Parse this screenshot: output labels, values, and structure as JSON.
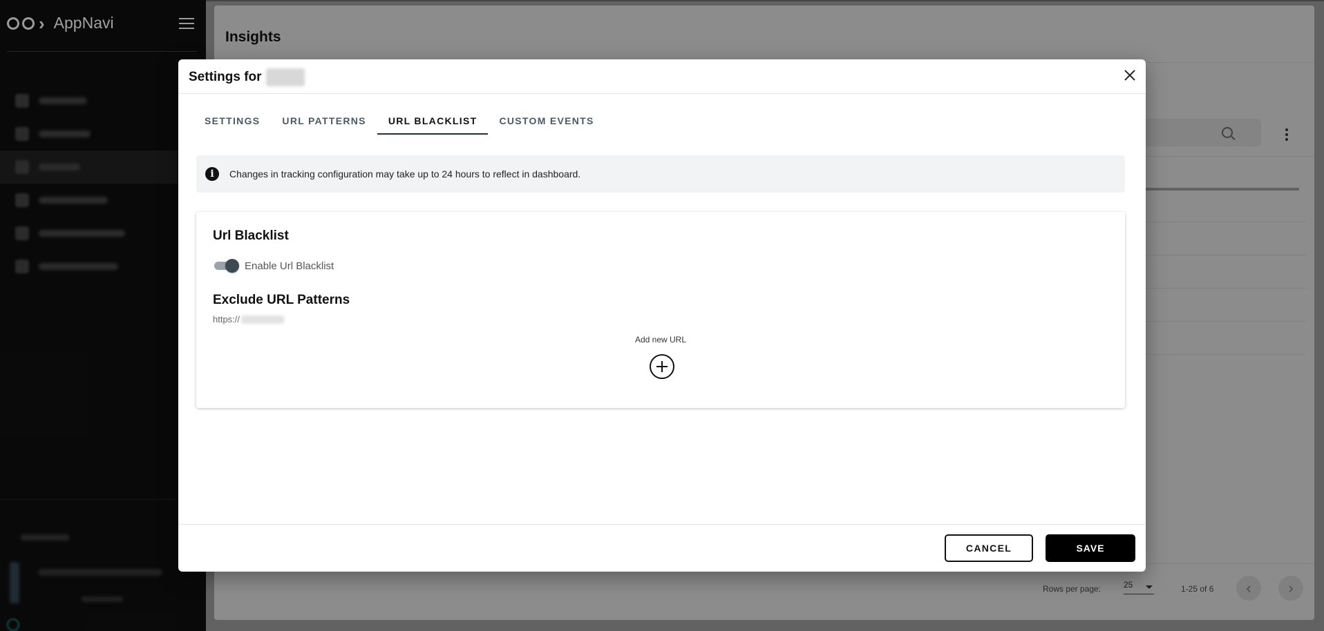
{
  "app": {
    "name": "AppNavi"
  },
  "sidebar": {
    "items": [
      {
        "icon": "dashboard-icon",
        "label": ""
      },
      {
        "icon": "discovery-icon",
        "label": ""
      },
      {
        "icon": "insights-icon",
        "label": ""
      },
      {
        "icon": "media-library-icon",
        "label": ""
      },
      {
        "icon": "target-audience-icon",
        "label": ""
      },
      {
        "icon": "message-board-icon",
        "label": ""
      }
    ],
    "active_index": 2
  },
  "page": {
    "title": "Insights",
    "pagination": {
      "rows_label": "Rows per page:",
      "rows_value": "25",
      "range": "1-25 of 6"
    }
  },
  "modal": {
    "title": "Settings for",
    "tabs": [
      {
        "label": "Settings"
      },
      {
        "label": "URL Patterns"
      },
      {
        "label": "URL Blacklist"
      },
      {
        "label": "Custom Events"
      }
    ],
    "active_tab": 2,
    "info_text": "Changes in tracking configuration may take up to 24 hours to reflect in dashboard.",
    "card": {
      "title": "Url Blacklist",
      "toggle_label": "Enable Url Blacklist",
      "toggle_on": true,
      "section_title": "Exclude URL Patterns",
      "url_prefix": "https://",
      "add_label": "Add new URL"
    },
    "buttons": {
      "cancel": "CANCEL",
      "save": "SAVE"
    }
  },
  "colors": {
    "sidebar_bg": "#0d0d0d",
    "primary": "#000000",
    "tab_underline": "#1f3240",
    "toggle_knob": "#3d4a52",
    "overlay": "#9a9a9a"
  }
}
